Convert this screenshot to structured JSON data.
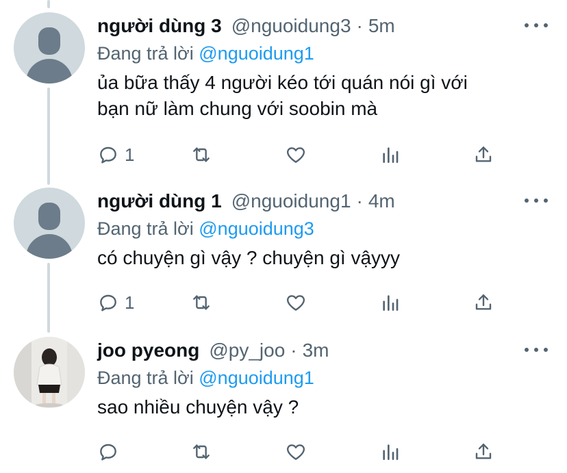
{
  "colors": {
    "text": "#0f1419",
    "secondary": "#536471",
    "link": "#1d9bf0",
    "thread": "#cfd9de"
  },
  "tweets": [
    {
      "name": "người dùng 3",
      "handle": "@nguoidung3",
      "separator": "·",
      "time": "5m",
      "reply_prefix": "Đang trả lời ",
      "reply_mention": "@nguoidung1",
      "text_lines": [
        "ủa bữa thấy 4 người kéo tới quán nói gì với",
        "bạn nữ làm chung với soobin mà"
      ],
      "reply_count": "1",
      "avatar": "default-avatar-icon"
    },
    {
      "name": "người dùng 1",
      "handle": "@nguoidung1",
      "separator": "·",
      "time": "4m",
      "reply_prefix": "Đang trả lời ",
      "reply_mention": "@nguoidung3",
      "text_lines": [
        "có chuyện gì vậy ? chuyện gì vậyyy"
      ],
      "reply_count": "1",
      "avatar": "default-avatar-icon"
    },
    {
      "name": "joo pyeong",
      "handle": "@py_joo",
      "separator": "·",
      "time": "3m",
      "reply_prefix": "Đang trả lời ",
      "reply_mention": "@nguoidung1",
      "text_lines": [
        "sao nhiều chuyện vậy ?"
      ],
      "reply_count": "",
      "avatar": "profile-photo"
    }
  ]
}
